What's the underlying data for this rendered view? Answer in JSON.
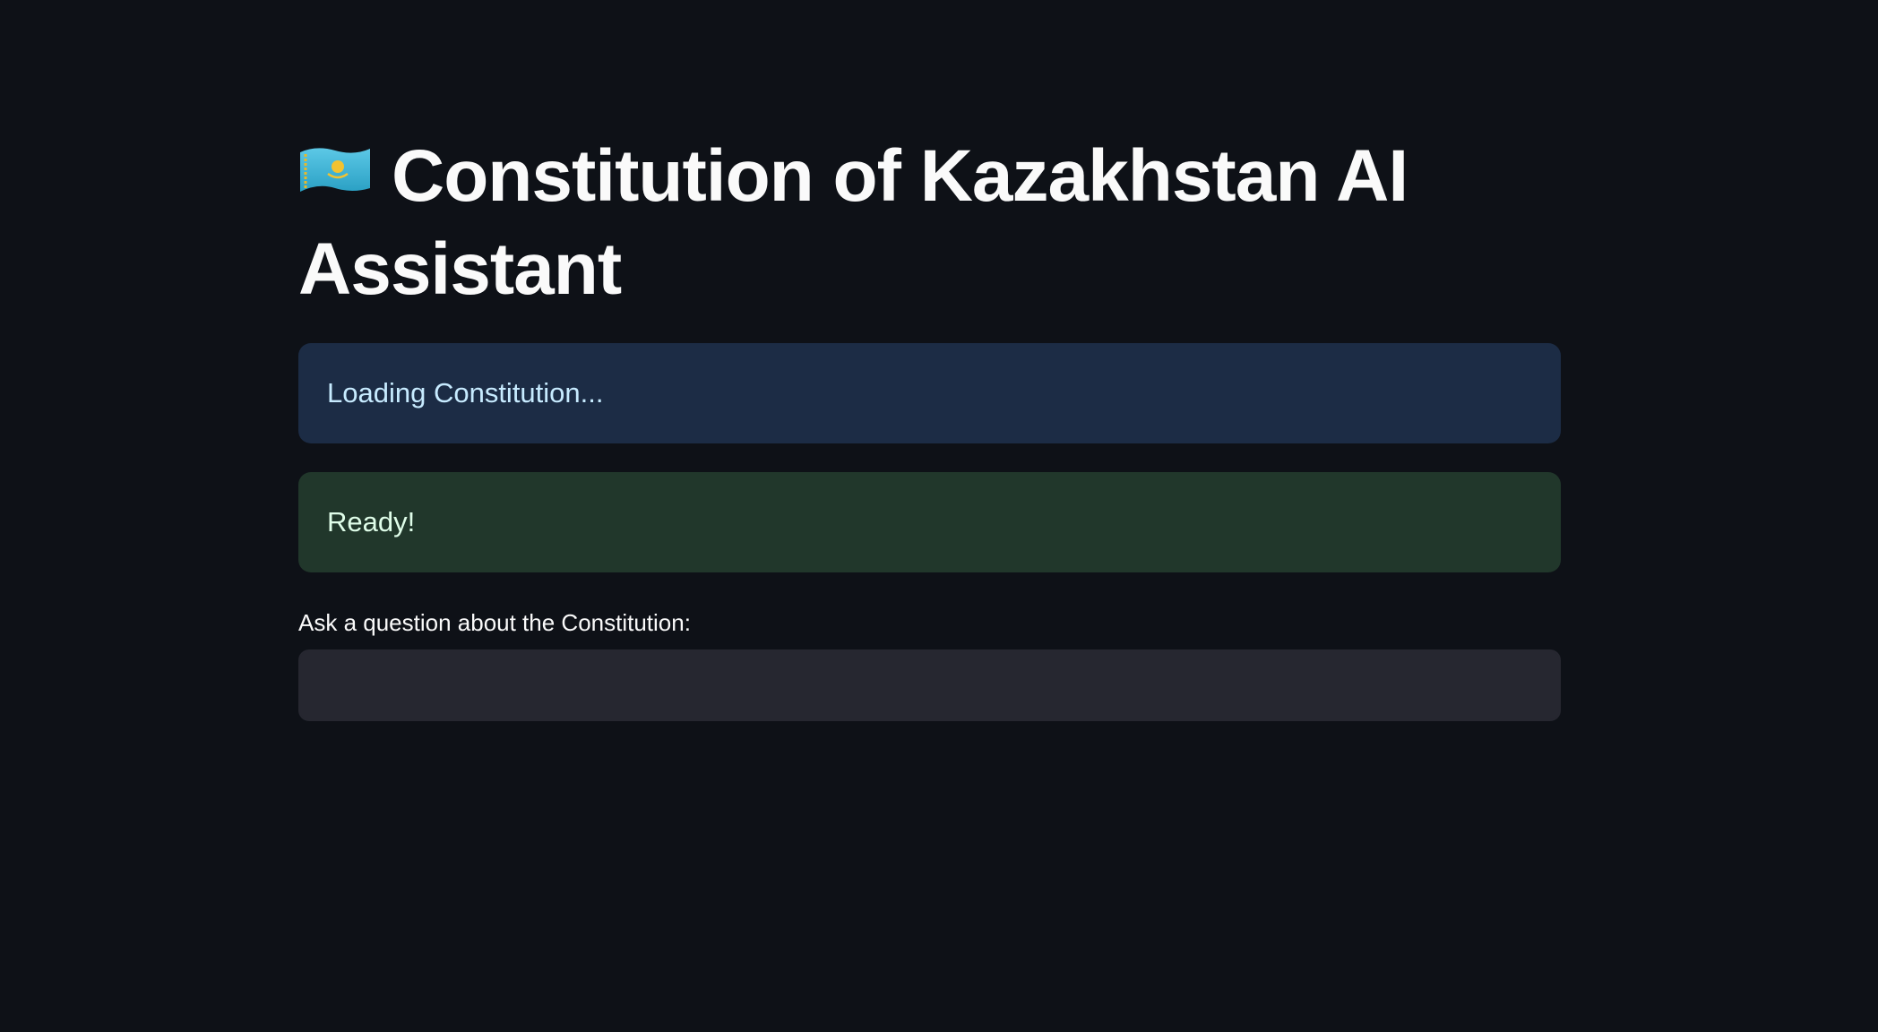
{
  "page": {
    "title": "Constitution of Kazakhstan AI Assistant",
    "title_icon": "kazakhstan-flag-icon"
  },
  "status": {
    "loading_text": "Loading Constitution...",
    "ready_text": "Ready!"
  },
  "question": {
    "label": "Ask a question about the Constitution:",
    "value": ""
  },
  "colors": {
    "background": "#0e1117",
    "info_bg": "#1c2c45",
    "success_bg": "#21372b",
    "input_bg": "#262730",
    "flag_blue": "#3fb5d6",
    "flag_gold": "#f2c230"
  }
}
